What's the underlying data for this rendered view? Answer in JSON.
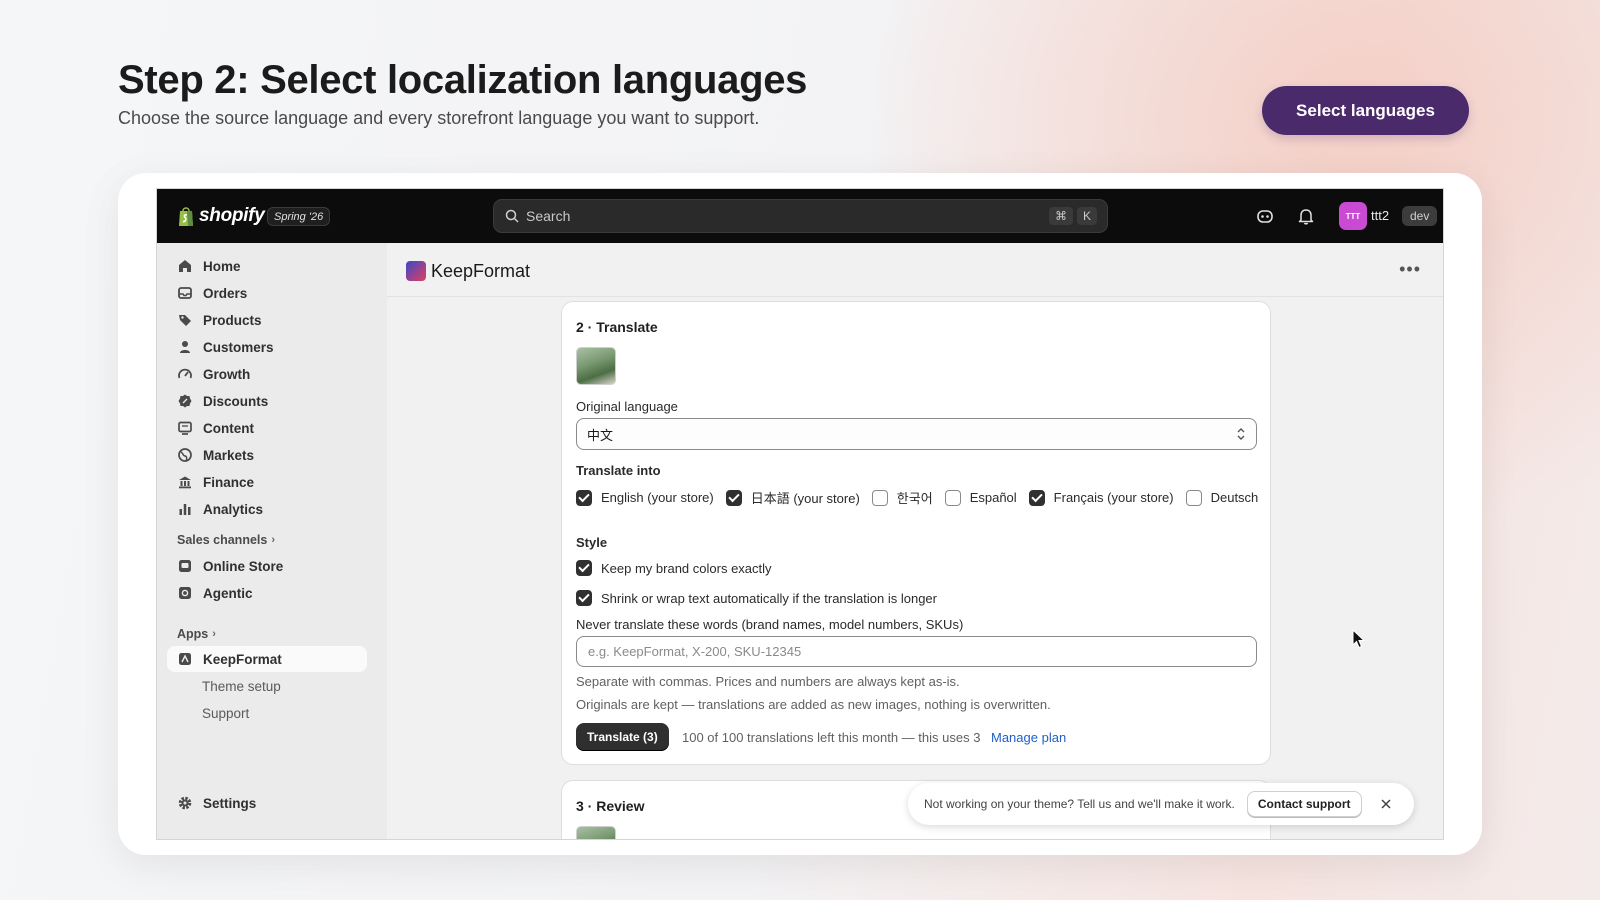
{
  "hero": {
    "title": "Step 2: Select localization languages",
    "subtitle": "Choose the source language and every storefront language you want to support.",
    "cta": "Select languages"
  },
  "topbar": {
    "brand": "shopify",
    "release": "Spring '26",
    "search_placeholder": "Search",
    "shortcut_cmd": "⌘",
    "shortcut_key": "K",
    "avatar_initials": "TTT",
    "user": "ttt2",
    "env": "dev"
  },
  "sidebar": {
    "items": [
      {
        "label": "Home",
        "icon": "home-icon"
      },
      {
        "label": "Orders",
        "icon": "inbox-icon"
      },
      {
        "label": "Products",
        "icon": "tag-icon"
      },
      {
        "label": "Customers",
        "icon": "person-icon"
      },
      {
        "label": "Growth",
        "icon": "gauge-icon"
      },
      {
        "label": "Discounts",
        "icon": "discount-icon"
      },
      {
        "label": "Content",
        "icon": "content-icon"
      },
      {
        "label": "Markets",
        "icon": "globe-icon"
      },
      {
        "label": "Finance",
        "icon": "bank-icon"
      },
      {
        "label": "Analytics",
        "icon": "bar-chart-icon"
      }
    ],
    "sales_channels_label": "Sales channels",
    "channels": [
      {
        "label": "Online Store",
        "icon": "store-icon"
      },
      {
        "label": "Agentic",
        "icon": "agentic-icon"
      }
    ],
    "apps_label": "Apps",
    "app_active": "KeepFormat",
    "app_subitems": [
      "Theme setup",
      "Support"
    ],
    "settings": "Settings"
  },
  "app": {
    "title": "KeepFormat",
    "translate_card": {
      "title": "2 · Translate",
      "original_language_label": "Original language",
      "original_language_value": "中文",
      "translate_into_label": "Translate into",
      "languages": [
        {
          "label": "English (your store)",
          "checked": true
        },
        {
          "label": "日本語 (your store)",
          "checked": true
        },
        {
          "label": "한국어",
          "checked": false
        },
        {
          "label": "Español",
          "checked": false
        },
        {
          "label": "Français (your store)",
          "checked": true
        },
        {
          "label": "Deutsch",
          "checked": false
        }
      ],
      "style_label": "Style",
      "style_options": [
        {
          "label": "Keep my brand colors exactly",
          "checked": true
        },
        {
          "label": "Shrink or wrap text automatically if the translation is longer",
          "checked": true
        }
      ],
      "never_translate_label": "Never translate these words (brand names, model numbers, SKUs)",
      "never_translate_placeholder": "e.g. KeepFormat, X-200, SKU-12345",
      "hint_1": "Separate with commas. Prices and numbers are always kept as-is.",
      "hint_2": "Originals are kept — translations are added as new images, nothing is overwritten.",
      "translate_button": "Translate (3)",
      "quota": "100 of 100 translations left this month — this uses 3",
      "manage_plan": "Manage plan"
    },
    "review_card": {
      "title": "3 · Review"
    },
    "toast": {
      "text": "Not working on your theme? Tell us and we'll make it work.",
      "button": "Contact support"
    }
  },
  "colors": {
    "cta": "#4b2a6c",
    "topbar": "#0c0c0c",
    "link": "#1f5fc9",
    "checkbox_on": "#303030"
  }
}
